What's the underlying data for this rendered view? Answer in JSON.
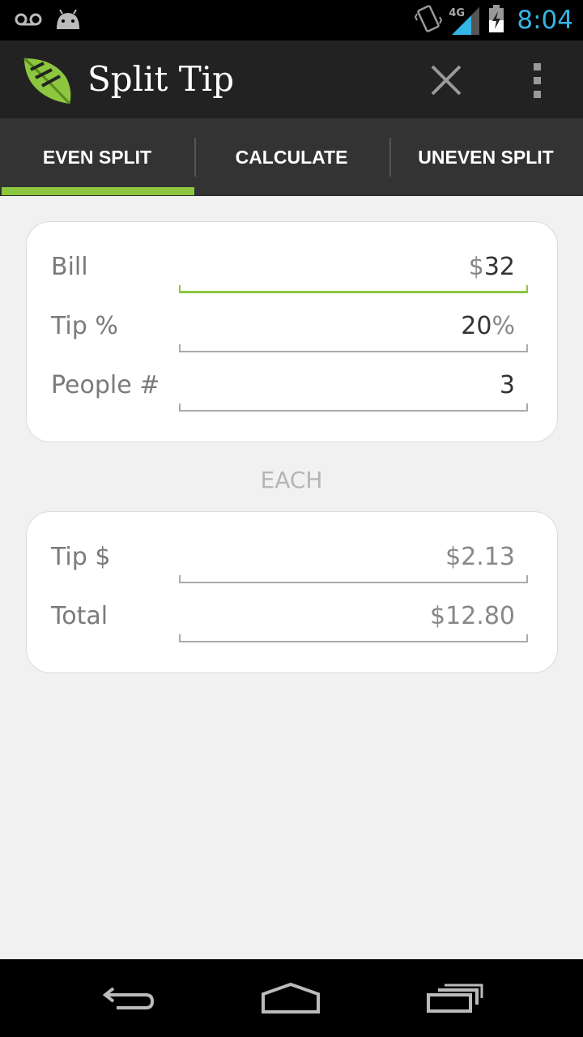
{
  "status_bar": {
    "time": "8:04",
    "network_label": "4G",
    "icons": [
      "voicemail-icon",
      "android-icon",
      "vibrate-icon",
      "signal-icon",
      "battery-charging-icon"
    ]
  },
  "action_bar": {
    "title": "Split Tip",
    "icons": [
      "leaf-logo-icon",
      "close-icon",
      "overflow-menu-icon"
    ]
  },
  "tabs": [
    {
      "label": "EVEN SPLIT",
      "selected": true
    },
    {
      "label": "CALCULATE",
      "selected": false
    },
    {
      "label": "UNEVEN SPLIT",
      "selected": false
    }
  ],
  "inputs": {
    "bill": {
      "label": "Bill",
      "prefix": "$",
      "value": "32"
    },
    "tip_percent": {
      "label": "Tip %",
      "value": "20",
      "suffix": "%"
    },
    "people": {
      "label": "People #",
      "value": "3"
    }
  },
  "section_label": "EACH",
  "results": {
    "tip": {
      "label": "Tip $",
      "value": "$2.13"
    },
    "total": {
      "label": "Total",
      "value": "$12.80"
    }
  },
  "nav_bar": {
    "icons": [
      "back-icon",
      "home-icon",
      "recent-apps-icon"
    ]
  },
  "colors": {
    "accent": "#8dc63f",
    "clock": "#33b5e5",
    "action_bar": "#222222",
    "tab_bar": "#333333",
    "background": "#f1f1f1"
  }
}
